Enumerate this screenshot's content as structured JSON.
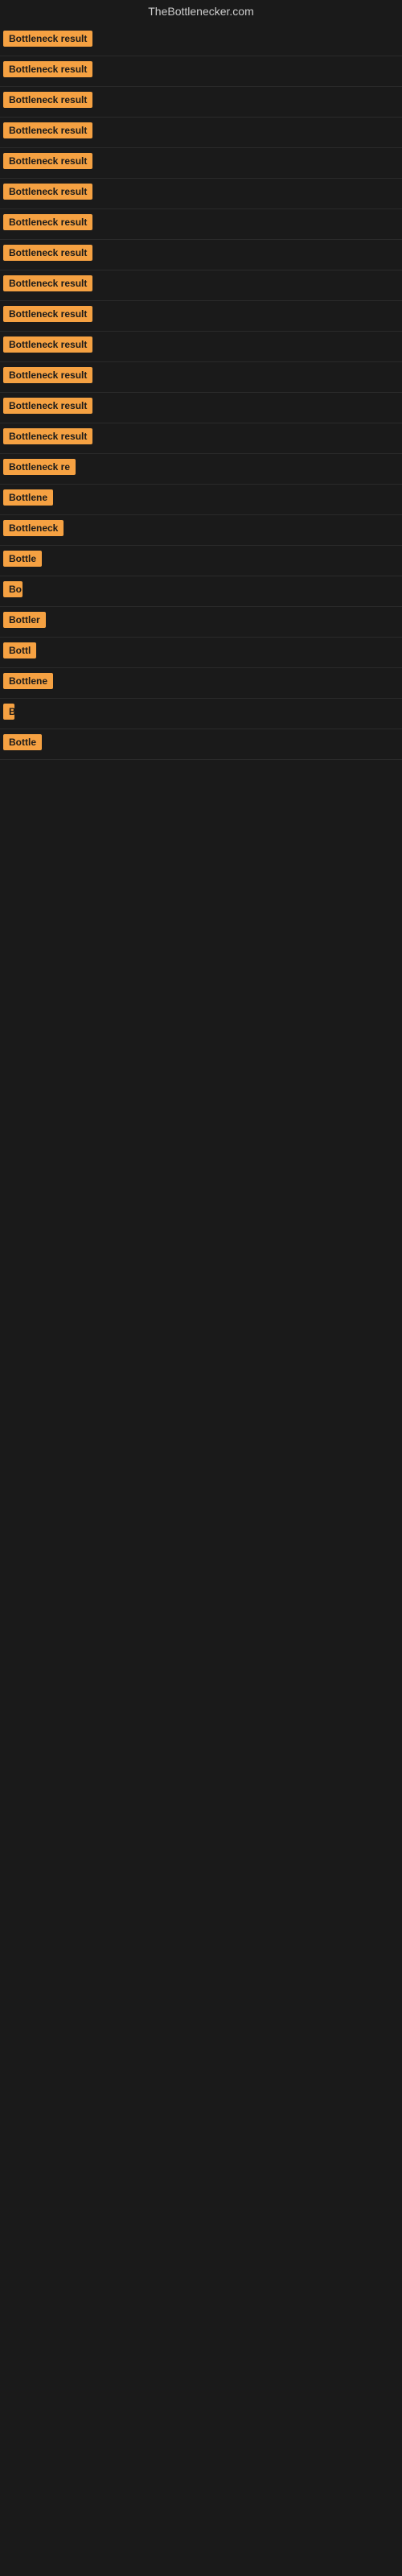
{
  "site": {
    "title": "TheBottlenecker.com"
  },
  "results": [
    {
      "id": 1,
      "label": "Bottleneck result",
      "width": 130
    },
    {
      "id": 2,
      "label": "Bottleneck result",
      "width": 130
    },
    {
      "id": 3,
      "label": "Bottleneck result",
      "width": 130
    },
    {
      "id": 4,
      "label": "Bottleneck result",
      "width": 130
    },
    {
      "id": 5,
      "label": "Bottleneck result",
      "width": 130
    },
    {
      "id": 6,
      "label": "Bottleneck result",
      "width": 130
    },
    {
      "id": 7,
      "label": "Bottleneck result",
      "width": 130
    },
    {
      "id": 8,
      "label": "Bottleneck result",
      "width": 130
    },
    {
      "id": 9,
      "label": "Bottleneck result",
      "width": 130
    },
    {
      "id": 10,
      "label": "Bottleneck result",
      "width": 130
    },
    {
      "id": 11,
      "label": "Bottleneck result",
      "width": 130
    },
    {
      "id": 12,
      "label": "Bottleneck result",
      "width": 130
    },
    {
      "id": 13,
      "label": "Bottleneck result",
      "width": 130
    },
    {
      "id": 14,
      "label": "Bottleneck result",
      "width": 120
    },
    {
      "id": 15,
      "label": "Bottleneck re",
      "width": 90
    },
    {
      "id": 16,
      "label": "Bottlene",
      "width": 68
    },
    {
      "id": 17,
      "label": "Bottleneck",
      "width": 78
    },
    {
      "id": 18,
      "label": "Bottle",
      "width": 52
    },
    {
      "id": 19,
      "label": "Bo",
      "width": 24
    },
    {
      "id": 20,
      "label": "Bottler",
      "width": 54
    },
    {
      "id": 21,
      "label": "Bottl",
      "width": 44
    },
    {
      "id": 22,
      "label": "Bottlene",
      "width": 66
    },
    {
      "id": 23,
      "label": "B",
      "width": 14
    },
    {
      "id": 24,
      "label": "Bottle",
      "width": 50
    }
  ],
  "colors": {
    "badge_bg": "#f5a142",
    "badge_text": "#1a1a1a",
    "page_bg": "#1a1a1a",
    "title_color": "#cccccc"
  }
}
